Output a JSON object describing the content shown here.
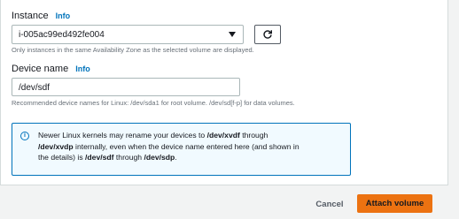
{
  "colors": {
    "accent": "#0073bb",
    "primary_button": "#ec7211",
    "alert_background": "#f1faff"
  },
  "instance": {
    "label": "Instance",
    "info_link": "Info",
    "selected_value": "i-005ac99ed492fe004",
    "caret_icon": "caret-down-icon",
    "refresh_icon": "refresh-icon",
    "hint": "Only instances in the same Availability Zone as the selected volume are displayed."
  },
  "device": {
    "label": "Device name",
    "info_link": "Info",
    "value": "/dev/sdf",
    "hint": "Recommended device names for Linux: /dev/sda1 for root volume. /dev/sd[f-p] for data volumes."
  },
  "alert": {
    "icon": "info-circle-icon",
    "line1_pre": "Newer Linux kernels may rename your devices to ",
    "line1_b1": "/dev/xvdf",
    "line1_post": " through",
    "line2_b1": "/dev/xvdp",
    "line2_post": " internally, even when the device name entered here (and shown in",
    "line3_pre": "the details) is ",
    "line3_b1": "/dev/sdf",
    "line3_mid": " through ",
    "line3_b2": "/dev/sdp",
    "line3_post": "."
  },
  "footer": {
    "cancel_label": "Cancel",
    "attach_label": "Attach volume"
  }
}
